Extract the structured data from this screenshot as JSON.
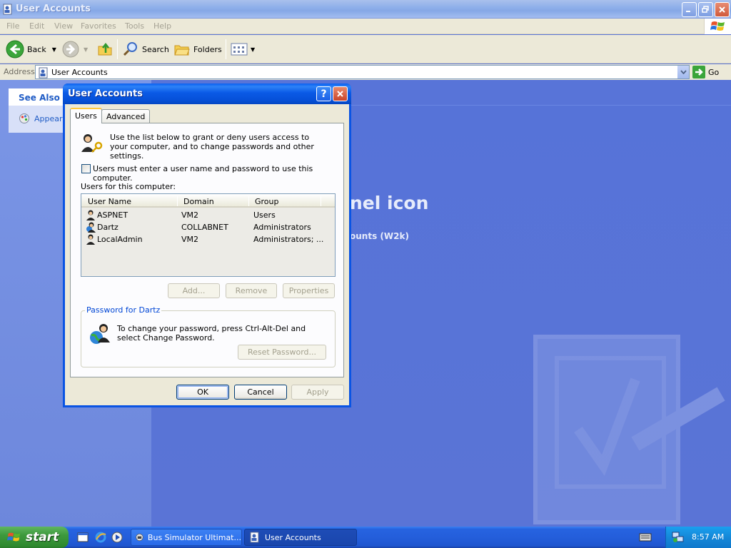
{
  "window": {
    "title": "User Accounts"
  },
  "menu": [
    "File",
    "Edit",
    "View",
    "Favorites",
    "Tools",
    "Help"
  ],
  "toolbar": {
    "back": "Back",
    "search": "Search",
    "folders": "Folders"
  },
  "address": {
    "label": "Address",
    "value": "User Accounts",
    "go": "Go"
  },
  "sidebar": {
    "see_also_title": "See Also",
    "see_also_item": "Appeara"
  },
  "content": {
    "heading_partial": "nel icon",
    "subheading_partial": "ounts (W2k)"
  },
  "dialog": {
    "title": "User Accounts",
    "tabs": [
      "Users",
      "Advanced"
    ],
    "intro": "Use the list below to grant or deny users access to your computer, and to change passwords and other settings.",
    "checkbox_label": "Users must enter a user name and password to use this computer.",
    "checkbox_checked": false,
    "users_label": "Users for this computer:",
    "columns": [
      "User Name",
      "Domain",
      "Group"
    ],
    "users": [
      {
        "name": "ASPNET",
        "domain": "VM2",
        "group": "Users"
      },
      {
        "name": "Dartz",
        "domain": "COLLABNET",
        "group": "Administrators"
      },
      {
        "name": "LocalAdmin",
        "domain": "VM2",
        "group": "Administrators; ..."
      }
    ],
    "buttons": {
      "add": "Add...",
      "remove": "Remove",
      "properties": "Properties"
    },
    "password_group_title": "Password for Dartz",
    "password_text": "To change your password, press Ctrl-Alt-Del and select Change Password.",
    "reset_password": "Reset Password...",
    "ok": "OK",
    "cancel": "Cancel",
    "apply": "Apply"
  },
  "taskbar": {
    "start": "start",
    "tasks": [
      "Bus Simulator Ultimat...",
      "User Accounts"
    ],
    "clock": "8:57 AM"
  }
}
